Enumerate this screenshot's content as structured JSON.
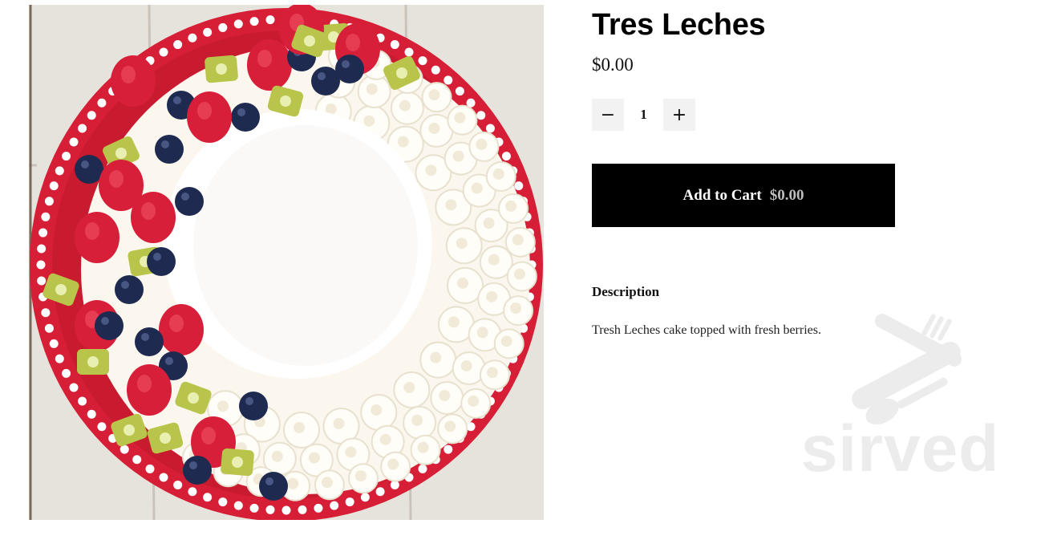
{
  "product": {
    "title": "Tres Leches",
    "price": "$0.00",
    "image_alt": "Tres Leches cake topped with berries and kiwi"
  },
  "quantity": {
    "decrement_icon": "minus-icon",
    "increment_icon": "plus-icon",
    "decrement_symbol": "−",
    "increment_symbol": "+",
    "value": "1"
  },
  "cart": {
    "label": "Add to Cart",
    "price": "$0.00"
  },
  "description": {
    "heading": "Description",
    "text": "Tresh Leches cake topped with fresh berries."
  },
  "watermark": {
    "text": "sirved",
    "icon": "knife-fork-spoon-icon"
  },
  "colors": {
    "button_bg": "#000000",
    "button_text": "#ffffff",
    "button_price": "#bdbdbd",
    "qty_bg": "#f2f2f2",
    "plate_red": "#d61f36",
    "watermark": "#ececec"
  }
}
